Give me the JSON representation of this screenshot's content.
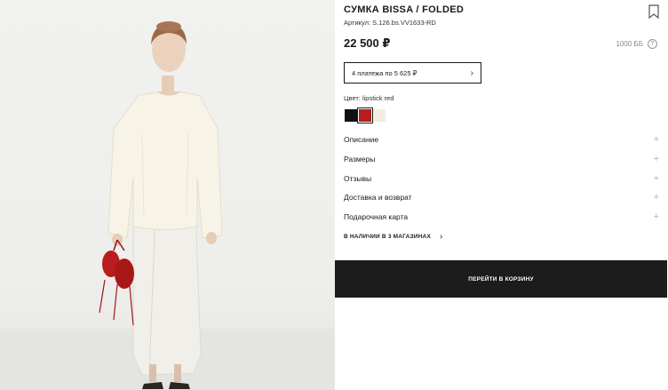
{
  "product": {
    "title": "СУМКА BISSA / FOLDED",
    "sku": "Артикул: S.126.bs.VV1633-RD",
    "price": "22 500 ₽",
    "bonus": "1000 ББ",
    "help_glyph": "?",
    "installments": "4 платежа по 5 625 ₽",
    "installments_chevron": "›",
    "color_label": "Цвет: lipstick red",
    "swatches": [
      {
        "name": "black",
        "color": "#111111"
      },
      {
        "name": "lipstick red",
        "color": "#b81c1c",
        "selected": true
      },
      {
        "name": "cream",
        "color": "#f2ede0"
      }
    ]
  },
  "accordion": [
    {
      "label": "Описание",
      "plus": "+"
    },
    {
      "label": "Размеры",
      "plus": "+"
    },
    {
      "label": "Отзывы",
      "plus": "+"
    },
    {
      "label": "Доставка и возврат",
      "plus": "+"
    },
    {
      "label": "Подарочная карта",
      "plus": "+"
    }
  ],
  "stores": {
    "label": "В НАЛИЧИИ В 3 МАГАЗИНАХ",
    "chevron": "›"
  },
  "cart_button": "ПЕРЕЙТИ В КОРЗИНУ",
  "icons": {
    "bookmark": "bookmark-icon",
    "help": "help-icon",
    "chevron": "chevron-right-icon",
    "plus": "plus-icon"
  },
  "colors": {
    "button_bg": "#1c1c1c",
    "bag_red": "#b81c1c"
  }
}
